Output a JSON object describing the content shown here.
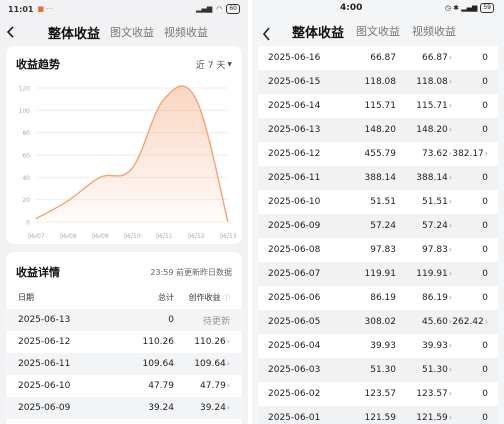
{
  "left": {
    "status": {
      "time": "11:01",
      "network": "5G",
      "battery": "60"
    },
    "tabs": [
      "整体收益",
      "图文收益",
      "视频收益"
    ],
    "trend": {
      "title": "收益趋势",
      "range": "近 7 天"
    },
    "detail": {
      "title": "收益详情",
      "note": "23:59 前更新昨日数据",
      "headers": {
        "date": "日期",
        "total": "总计",
        "create": "创作收益"
      },
      "rows": [
        {
          "date": "2025-06-13",
          "total": "0",
          "create": "待更新",
          "pending": true
        },
        {
          "date": "2025-06-12",
          "total": "110.26",
          "create": "110.26"
        },
        {
          "date": "2025-06-11",
          "total": "109.64",
          "create": "109.64"
        },
        {
          "date": "2025-06-10",
          "total": "47.79",
          "create": "47.79"
        },
        {
          "date": "2025-06-09",
          "total": "39.24",
          "create": "39.24"
        }
      ]
    }
  },
  "right": {
    "status": {
      "time": "4:00",
      "battery": "59"
    },
    "tabs": [
      "整体收益",
      "图文收益",
      "视频收益"
    ],
    "rows": [
      {
        "date": "2025-06-16",
        "total": "66.87",
        "create": "66.87",
        "extra": "0"
      },
      {
        "date": "2025-06-15",
        "total": "118.08",
        "create": "118.08",
        "extra": "0"
      },
      {
        "date": "2025-06-14",
        "total": "115.71",
        "create": "115.71",
        "extra": "0"
      },
      {
        "date": "2025-06-13",
        "total": "148.20",
        "create": "148.20",
        "extra": "0"
      },
      {
        "date": "2025-06-12",
        "total": "455.79",
        "create": "73.62",
        "extra": "382.17",
        "extra_link": true
      },
      {
        "date": "2025-06-11",
        "total": "388.14",
        "create": "388.14",
        "extra": "0"
      },
      {
        "date": "2025-06-10",
        "total": "51.51",
        "create": "51.51",
        "extra": "0"
      },
      {
        "date": "2025-06-09",
        "total": "57.24",
        "create": "57.24",
        "extra": "0"
      },
      {
        "date": "2025-06-08",
        "total": "97.83",
        "create": "97.83",
        "extra": "0"
      },
      {
        "date": "2025-06-07",
        "total": "119.91",
        "create": "119.91",
        "extra": "0"
      },
      {
        "date": "2025-06-06",
        "total": "86.19",
        "create": "86.19",
        "extra": "0"
      },
      {
        "date": "2025-06-05",
        "total": "308.02",
        "create": "45.60",
        "extra": "262.42",
        "extra_link": true
      },
      {
        "date": "2025-06-04",
        "total": "39.93",
        "create": "39.93",
        "extra": "0"
      },
      {
        "date": "2025-06-03",
        "total": "51.30",
        "create": "51.30",
        "extra": "0"
      },
      {
        "date": "2025-06-02",
        "total": "123.57",
        "create": "123.57",
        "extra": "0"
      },
      {
        "date": "2025-06-01",
        "total": "121.59",
        "create": "121.59",
        "extra": "0"
      }
    ]
  },
  "chart_data": {
    "type": "area",
    "categories": [
      "06/07",
      "06/08",
      "06/09",
      "06/10",
      "06/11",
      "06/12",
      "06/13"
    ],
    "values": [
      3,
      19,
      40,
      48,
      110,
      110,
      0
    ],
    "yticks": [
      0,
      20,
      40,
      60,
      80,
      100,
      120
    ],
    "ylim": [
      0,
      120
    ],
    "color": "#f5a377",
    "title": "收益趋势"
  },
  "colors": {
    "accent": "#f5a377",
    "bg": "#f2f2f4"
  }
}
